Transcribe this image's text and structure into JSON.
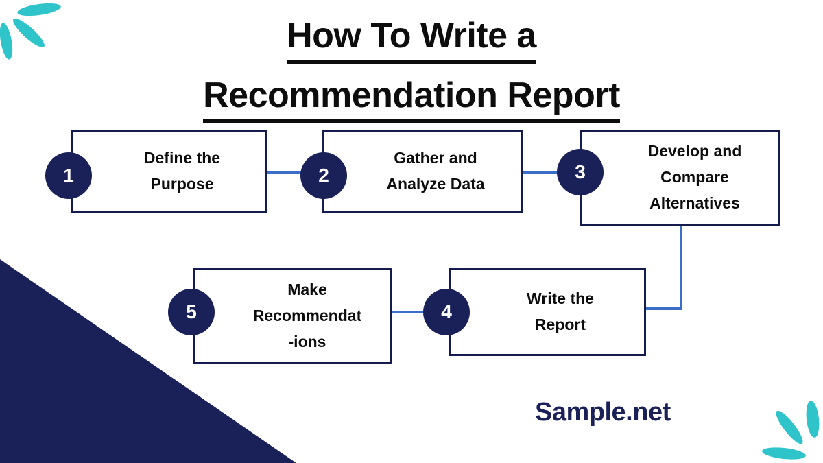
{
  "title": {
    "line1": "How To Write a",
    "line2": "Recommendation Report"
  },
  "brand": {
    "name": "Sample.net"
  },
  "colors": {
    "navy": "#1a2159",
    "border_navy": "#141b4d",
    "connector_blue": "#3b6ec9",
    "teal": "#2ec4c9",
    "text_black": "#0d0d0d",
    "background": "#ffffff"
  },
  "steps": [
    {
      "number": "1",
      "label": "Define the\nPurpose"
    },
    {
      "number": "2",
      "label": "Gather and\nAnalyze Data"
    },
    {
      "number": "3",
      "label": "Develop and\nCompare\nAlternatives"
    },
    {
      "number": "4",
      "label": "Write the\nReport"
    },
    {
      "number": "5",
      "label": "Make\nRecommendat\n-ions"
    }
  ],
  "decorations": {
    "top_left": "teal-leaves",
    "bottom_right": "teal-leaves",
    "bottom_left": "navy-triangle"
  }
}
